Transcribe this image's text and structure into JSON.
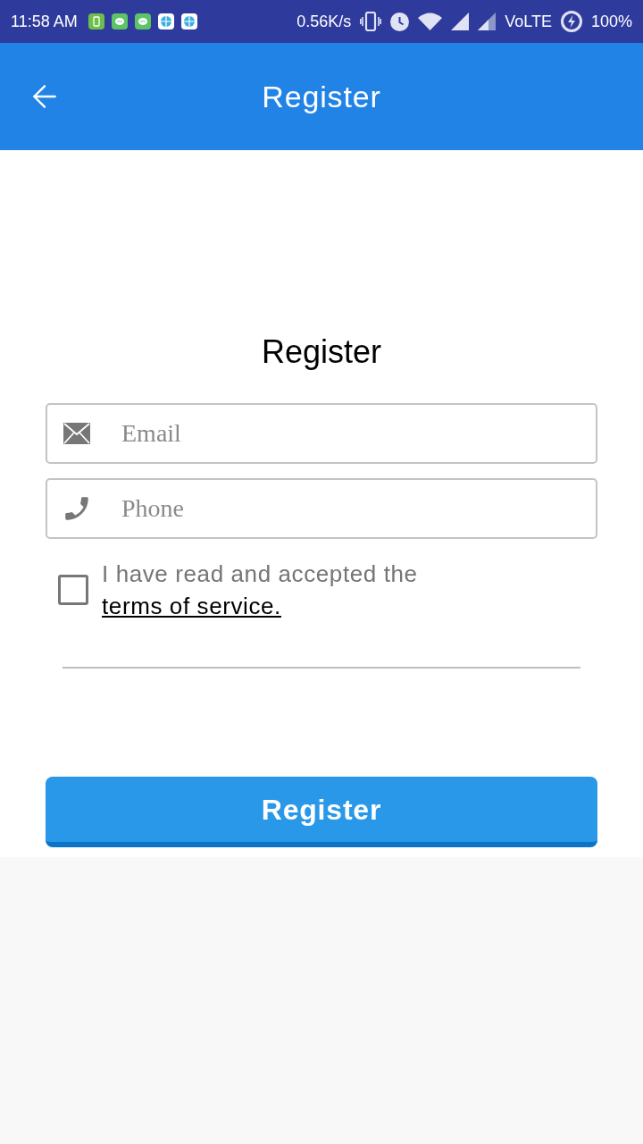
{
  "status_bar": {
    "time": "11:58 AM",
    "net_speed": "0.56K/s",
    "network": "VoLTE",
    "battery": "100%"
  },
  "app_bar": {
    "title": "Register"
  },
  "form": {
    "heading": "Register",
    "fields": [
      {
        "kind": "email",
        "placeholder": "Email"
      },
      {
        "kind": "phone",
        "placeholder": "Phone"
      }
    ],
    "terms": {
      "checked": false,
      "text": "I have read and accepted the",
      "link": "terms of service."
    },
    "submit": "Register"
  }
}
